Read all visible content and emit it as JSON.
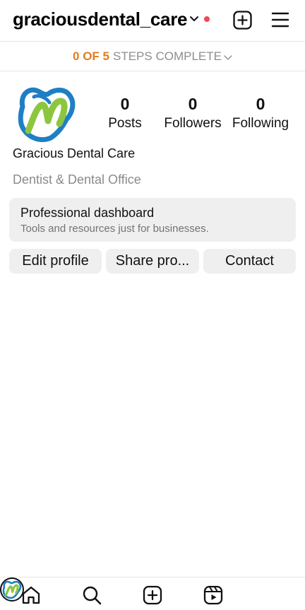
{
  "header": {
    "username": "graciousdental_care",
    "notification_dot_color": "#ed4956",
    "icons": [
      "chevron-down-icon",
      "add-icon",
      "menu-icon"
    ]
  },
  "steps": {
    "count": "0 OF 5",
    "label": "STEPS COMPLETE",
    "count_color": "#e17c20"
  },
  "profile": {
    "stats": [
      {
        "value": "0",
        "label": "Posts"
      },
      {
        "value": "0",
        "label": "Followers"
      },
      {
        "value": "0",
        "label": "Following"
      }
    ],
    "name": "Gracious Dental Care",
    "category": "Dentist & Dental Office"
  },
  "dashboard": {
    "title": "Professional dashboard",
    "subtitle": "Tools and resources just for businesses."
  },
  "actions": {
    "edit": "Edit profile",
    "share": "Share pro...",
    "contact": "Contact"
  },
  "nav": {
    "items": [
      "home-icon",
      "search-icon",
      "create-icon",
      "reels-icon",
      "profile-avatar"
    ]
  },
  "colors": {
    "logo_blue": "#1f7fc4",
    "logo_green": "#8cc63f",
    "button_bg": "#efefef"
  }
}
